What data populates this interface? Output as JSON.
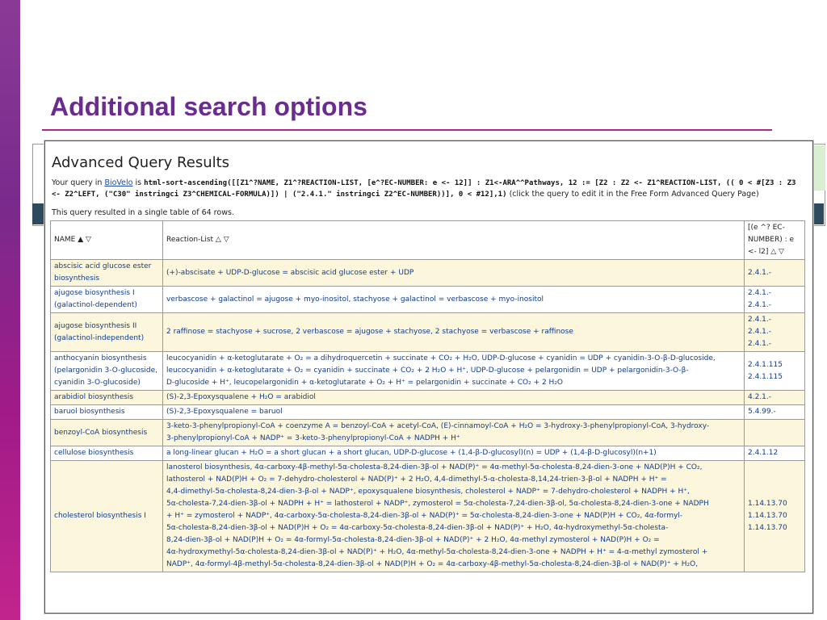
{
  "slide": {
    "title": "Additional search options"
  },
  "panel": {
    "heading": "Advanced Query Results",
    "query_prefix": "Your query in",
    "query_link": "BioVelo",
    "query_is": "is",
    "query_code": "html-sort-ascending([[Z1^?NAME, Z1^?REACTION-LIST, [e^?EC-NUMBER: e <- 12]] : Z1<-ARA^^Pathways, 12 := [Z2 : Z2 <- Z1^REACTION-LIST, (( 0 < #[Z3 : Z3 <- Z2^LEFT, (\"C30\" instringci Z3^CHEMICAL-FORMULA)]) | (\"2.4.1.\" instringci Z2^EC-NUMBER))], 0 < #12],1)",
    "query_suffix": "(click the query to edit it in the Free Form Advanced Query Page)",
    "result_note": "This query resulted in a single table of 64 rows."
  },
  "table": {
    "headers": {
      "name": "NAME ▲ ▽",
      "reactions": "Reaction-List △ ▽",
      "ec": "[(e ^? EC-NUMBER) : e <- l2] △ ▽"
    },
    "rows": [
      {
        "name": "abscisic acid glucose ester biosynthesis",
        "reactions": [
          "(+)-abscisate + UDP-D-glucose = abscisic acid glucose ester + UDP"
        ],
        "ec": [
          "2.4.1.-"
        ]
      },
      {
        "name": "ajugose biosynthesis I (galactinol-dependent)",
        "reactions": [
          "verbascose + galactinol = ajugose + myo-inositol, stachyose + galactinol = verbascose + myo-inositol"
        ],
        "ec": [
          "2.4.1.-",
          "2.4.1.-"
        ]
      },
      {
        "name": "ajugose biosynthesis II (galactinol-independent)",
        "reactions": [
          "2 raffinose = stachyose + sucrose, 2 verbascose = ajugose + stachyose, 2 stachyose = verbascose + raffinose"
        ],
        "ec": [
          "2.4.1.-",
          "2.4.1.-",
          "2.4.1.-"
        ]
      },
      {
        "name": "anthocyanin biosynthesis (pelargonidin 3-O-glucoside, cyanidin 3-O-glucoside)",
        "reactions": [
          "leucocyanidin + α-ketoglutarate + O₂ = a dihydroquercetin + succinate + CO₂ + H₂O, UDP-D-glucose + cyanidin = UDP + cyanidin-3-O-β-D-glucoside,",
          "leucocyanidin + α-ketoglutarate + O₂ = cyanidin + succinate + CO₂ + 2 H₂O + H⁺, UDP-D-glucose + pelargonidin = UDP + pelargonidin-3-O-β-",
          "D-glucoside + H⁺, leucopelargonidin + α-ketoglutarate + O₂ + H⁺ = pelargonidin + succinate + CO₂ + 2 H₂O"
        ],
        "ec": [
          "2.4.1.115",
          "2.4.1.115"
        ]
      },
      {
        "name": "arabidiol biosynthesis",
        "reactions": [
          "(S)-2,3-Epoxysqualene + H₂O = arabidiol"
        ],
        "ec": [
          "4.2.1.-"
        ]
      },
      {
        "name": "baruol biosynthesis",
        "reactions": [
          "(S)-2,3-Epoxysqualene = baruol"
        ],
        "ec": [
          "5.4.99.-"
        ]
      },
      {
        "name": "benzoyl-CoA biosynthesis",
        "reactions": [
          "3-keto-3-phenylpropionyl-CoA + coenzyme A = benzoyl-CoA + acetyl-CoA, (E)-cinnamoyl-CoA + H₂O = 3-hydroxy-3-phenylpropionyl-CoA, 3-hydroxy-",
          "3-phenylpropionyl-CoA + NADP⁺ = 3-keto-3-phenylpropionyl-CoA + NADPH + H⁺"
        ],
        "ec": []
      },
      {
        "name": "cellulose biosynthesis",
        "reactions": [
          "a long-linear glucan + H₂O = a short glucan + a short glucan, UDP-D-glucose + (1,4-β-D-glucosyl)(n) = UDP + (1,4-β-D-glucosyl)(n+1)"
        ],
        "ec": [
          "2.4.1.12"
        ]
      },
      {
        "name": "cholesterol biosynthesis I",
        "reactions": [
          "lanosterol biosynthesis, 4α-carboxy-4β-methyl-5α-cholesta-8,24-dien-3β-ol + NAD(P)⁺ = 4α-methyl-5α-cholesta-8,24-dien-3-one + NAD(P)H + CO₂,",
          "lathosterol + NAD(P)H + O₂ = 7-dehydro-cholesterol + NAD(P)⁺ + 2 H₂O, 4,4-dimethyl-5-α-cholesta-8,14,24-trien-3-β-ol + NADPH + H⁺ =",
          "4,4-dimethyl-5α-cholesta-8,24-dien-3-β-ol + NADP⁺, epoxysqualene biosynthesis, cholesterol + NADP⁺ = 7-dehydro-cholesterol + NADPH + H⁺,",
          "5α-cholesta-7,24-dien-3β-ol + NADPH + H⁺ = lathosterol + NADP⁺, zymosterol = 5α-cholesta-7,24-dien-3β-ol, 5α-cholesta-8,24-dien-3-one + NADPH",
          "+ H⁺ = zymosterol + NADP⁺, 4α-carboxy-5α-cholesta-8,24-dien-3β-ol + NAD(P)⁺ = 5α-cholesta-8,24-dien-3-one + NAD(P)H + CO₂, 4α-formyl-",
          "5α-cholesta-8,24-dien-3β-ol + NAD(P)H + O₂ = 4α-carboxy-5α-cholesta-8,24-dien-3β-ol + NAD(P)⁺ + H₂O, 4α-hydroxymethyl-5α-cholesta-",
          "8,24-dien-3β-ol + NAD(P)H + O₂ = 4α-formyl-5α-cholesta-8,24-dien-3β-ol + NAD(P)⁺ + 2 H₂O, 4α-methyl zymosterol + NAD(P)H + O₂ =",
          "4α-hydroxymethyl-5α-cholesta-8,24-dien-3β-ol + NAD(P)⁺ + H₂O, 4α-methyl-5α-cholesta-8,24-dien-3-one + NADPH + H⁺ = 4-α-methyl zymosterol +",
          "NADP⁺, 4α-formyl-4β-methyl-5α-cholesta-8,24-dien-3β-ol + NAD(P)H + O₂ = 4α-carboxy-4β-methyl-5α-cholesta-8,24-dien-3β-ol + NAD(P)⁺ + H₂O,"
        ],
        "ec": [
          "1.14.13.70",
          "1.14.13.70",
          "1.14.13.70"
        ]
      }
    ]
  }
}
